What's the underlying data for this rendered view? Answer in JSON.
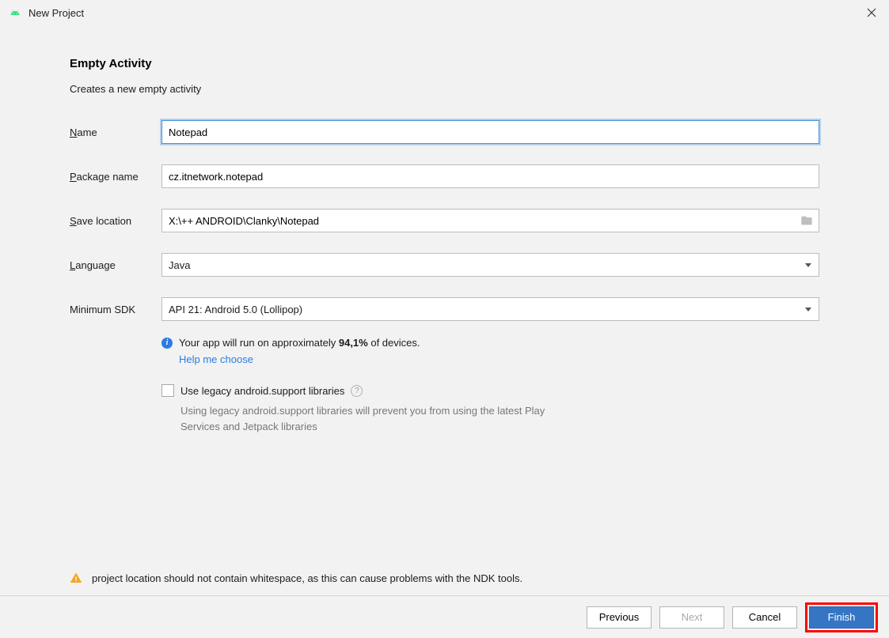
{
  "window": {
    "title": "New Project"
  },
  "header": {
    "heading": "Empty Activity",
    "subheading": "Creates a new empty activity"
  },
  "form": {
    "name_label": "Name",
    "name_value": "Notepad",
    "package_label": "Package name",
    "package_value": "cz.itnetwork.notepad",
    "save_label": "Save location",
    "save_value": "X:\\++ ANDROID\\Clanky\\Notepad",
    "language_label": "Language",
    "language_value": "Java",
    "minsdk_label": "Minimum SDK",
    "minsdk_value": "API 21: Android 5.0 (Lollipop)"
  },
  "info": {
    "run_prefix": "Your app will run on approximately ",
    "run_percent": "94,1%",
    "run_suffix": " of devices.",
    "help_link": "Help me choose"
  },
  "legacy": {
    "checkbox_label": "Use legacy android.support libraries",
    "description": "Using legacy android.support libraries will prevent you from using the latest Play Services and Jetpack libraries"
  },
  "warning": {
    "text": "project location should not contain whitespace, as this can cause problems with the NDK tools."
  },
  "buttons": {
    "previous": "Previous",
    "next": "Next",
    "cancel": "Cancel",
    "finish": "Finish"
  }
}
